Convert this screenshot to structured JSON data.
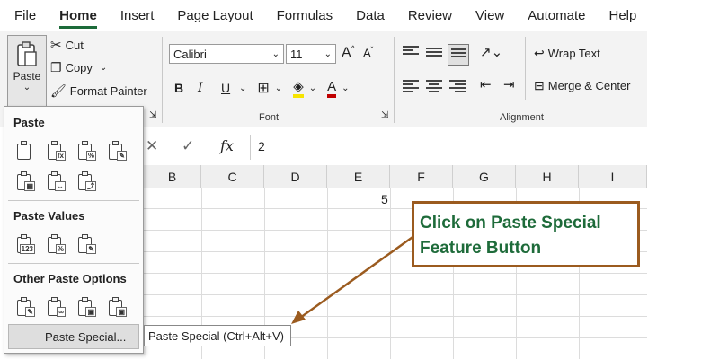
{
  "menu": {
    "tabs": [
      "File",
      "Home",
      "Insert",
      "Page Layout",
      "Formulas",
      "Data",
      "Review",
      "View",
      "Automate",
      "Help"
    ],
    "active": "Home"
  },
  "clipboard": {
    "paste_label": "Paste",
    "cut_label": "Cut",
    "copy_label": "Copy",
    "format_painter_label": "Format Painter"
  },
  "font": {
    "group_label": "Font",
    "name": "Calibri",
    "size": "11",
    "bold": "B",
    "italic": "I",
    "underline": "U"
  },
  "alignment": {
    "group_label": "Alignment",
    "wrap_text_label": "Wrap Text",
    "merge_center_label": "Merge & Center"
  },
  "formula_bar": {
    "cancel_symbol": "✕",
    "enter_symbol": "✓",
    "fx_label": "fx",
    "value": "2"
  },
  "grid": {
    "columns": [
      "B",
      "C",
      "D",
      "E",
      "F",
      "G",
      "H",
      "I"
    ],
    "cell_e1": "5"
  },
  "paste_menu": {
    "section_paste": "Paste",
    "section_paste_values": "Paste Values",
    "section_other": "Other Paste Options",
    "paste_special_label": "Paste Special...",
    "paste_special_tooltip": "Paste Special (Ctrl+Alt+V)"
  },
  "annotation": {
    "line1": "Click on Paste Special",
    "line2": "Feature Button",
    "border_color": "#9b5b1f",
    "text_color": "#1e6b3a"
  }
}
